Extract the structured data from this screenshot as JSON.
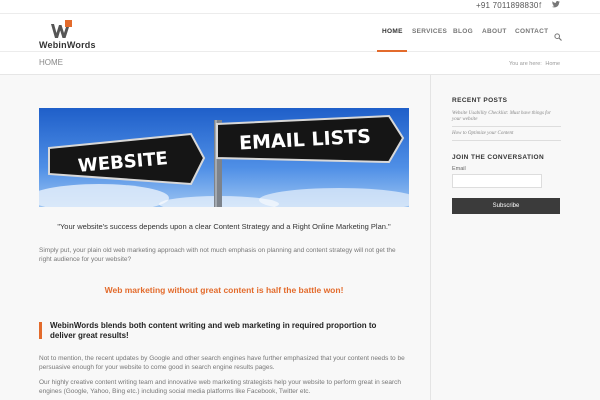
{
  "topbar": {
    "phone": "+91 7011898830",
    "icons": [
      "facebook-icon",
      "twitter-icon"
    ]
  },
  "logo": {
    "text": "WebinWords",
    "colors": {
      "w": "#555555",
      "accent": "#e36b2c"
    }
  },
  "nav": {
    "items": [
      "HOME",
      "SERVICES",
      "BLOG",
      "ABOUT",
      "CONTACT"
    ],
    "active": "HOME",
    "accent": "#e36b2c"
  },
  "titlebar": {
    "title": "HOME",
    "breadcrumb_prefix": "You are here:",
    "breadcrumb_current": "Home"
  },
  "hero": {
    "signs": [
      "WEBSITE",
      "EMAIL LISTS"
    ]
  },
  "content": {
    "quote": "\"Your website's success depends upon a clear Content Strategy and a Right Online Marketing Plan.\"",
    "para1": "Simply put, your plain old web marketing approach with not much emphasis on planning and content strategy will not get the right audience for your website?",
    "highlight": "Web marketing without great content is half the battle won!",
    "callout": "WebinWords blends both content writing and web marketing in required proportion to deliver great results!",
    "para2": "Not to mention, the recent updates by Google and other search engines have further emphasized that your content needs to be persuasive enough for your website to come good in search engine results pages.",
    "para3": "Our highly creative content writing team and innovative web marketing strategists help your website to perform great in search engines (Google, Yahoo, Bing etc.) including social media platforms like Facebook, Twitter etc."
  },
  "sidebar": {
    "recent_heading": "RECENT POSTS",
    "recent_posts": [
      "Website Usability Checklist: Must have things for your website",
      "How to Optimize your Content"
    ],
    "join_heading": "JOIN THE CONVERSATION",
    "email_label": "Email",
    "subscribe_label": "Subscribe"
  }
}
